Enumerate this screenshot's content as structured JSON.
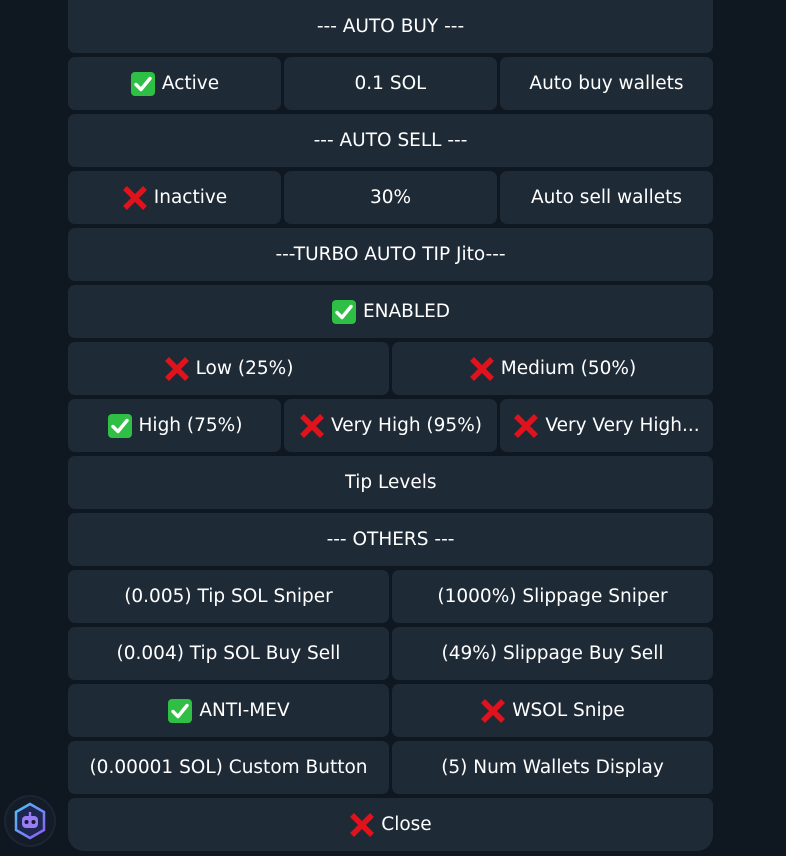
{
  "keyboard": {
    "auto_buy_header": "--- AUTO BUY ---",
    "auto_buy_status": "Active",
    "auto_buy_amount": "0.1 SOL",
    "auto_buy_wallets": "Auto buy wallets",
    "auto_sell_header": "--- AUTO SELL ---",
    "auto_sell_status": "Inactive",
    "auto_sell_amount": "30%",
    "auto_sell_wallets": "Auto sell wallets",
    "turbo_header": "---TURBO AUTO TIP Jito---",
    "turbo_status": "ENABLED",
    "tip_low": "Low (25%)",
    "tip_medium": "Medium (50%)",
    "tip_high": "High (75%)",
    "tip_very_high": "Very High (95%)",
    "tip_very_very_high": "Very Very High...",
    "tip_levels": "Tip Levels",
    "others_header": "--- OTHERS ---",
    "tip_sol_sniper": "(0.005) Tip SOL Sniper",
    "slippage_sniper": "(1000%) Slippage Sniper",
    "tip_sol_buy_sell": "(0.004) Tip SOL Buy Sell",
    "slippage_buy_sell": "(49%) Slippage Buy Sell",
    "anti_mev": "ANTI-MEV",
    "wsol_snipe": "WSOL Snipe",
    "custom_button": "(0.00001 SOL) Custom Button",
    "num_wallets_display": "(5) Num Wallets Display",
    "close": "Close"
  },
  "icons": {
    "check": "check-mark-icon",
    "cross": "cross-mark-icon",
    "bot_avatar": "bot-avatar-icon"
  },
  "colors": {
    "background": "#0f1721",
    "button": "#1f2a37",
    "text": "#ffffff",
    "check_green": "#2fbf45",
    "cross_red": "#e0131c"
  }
}
